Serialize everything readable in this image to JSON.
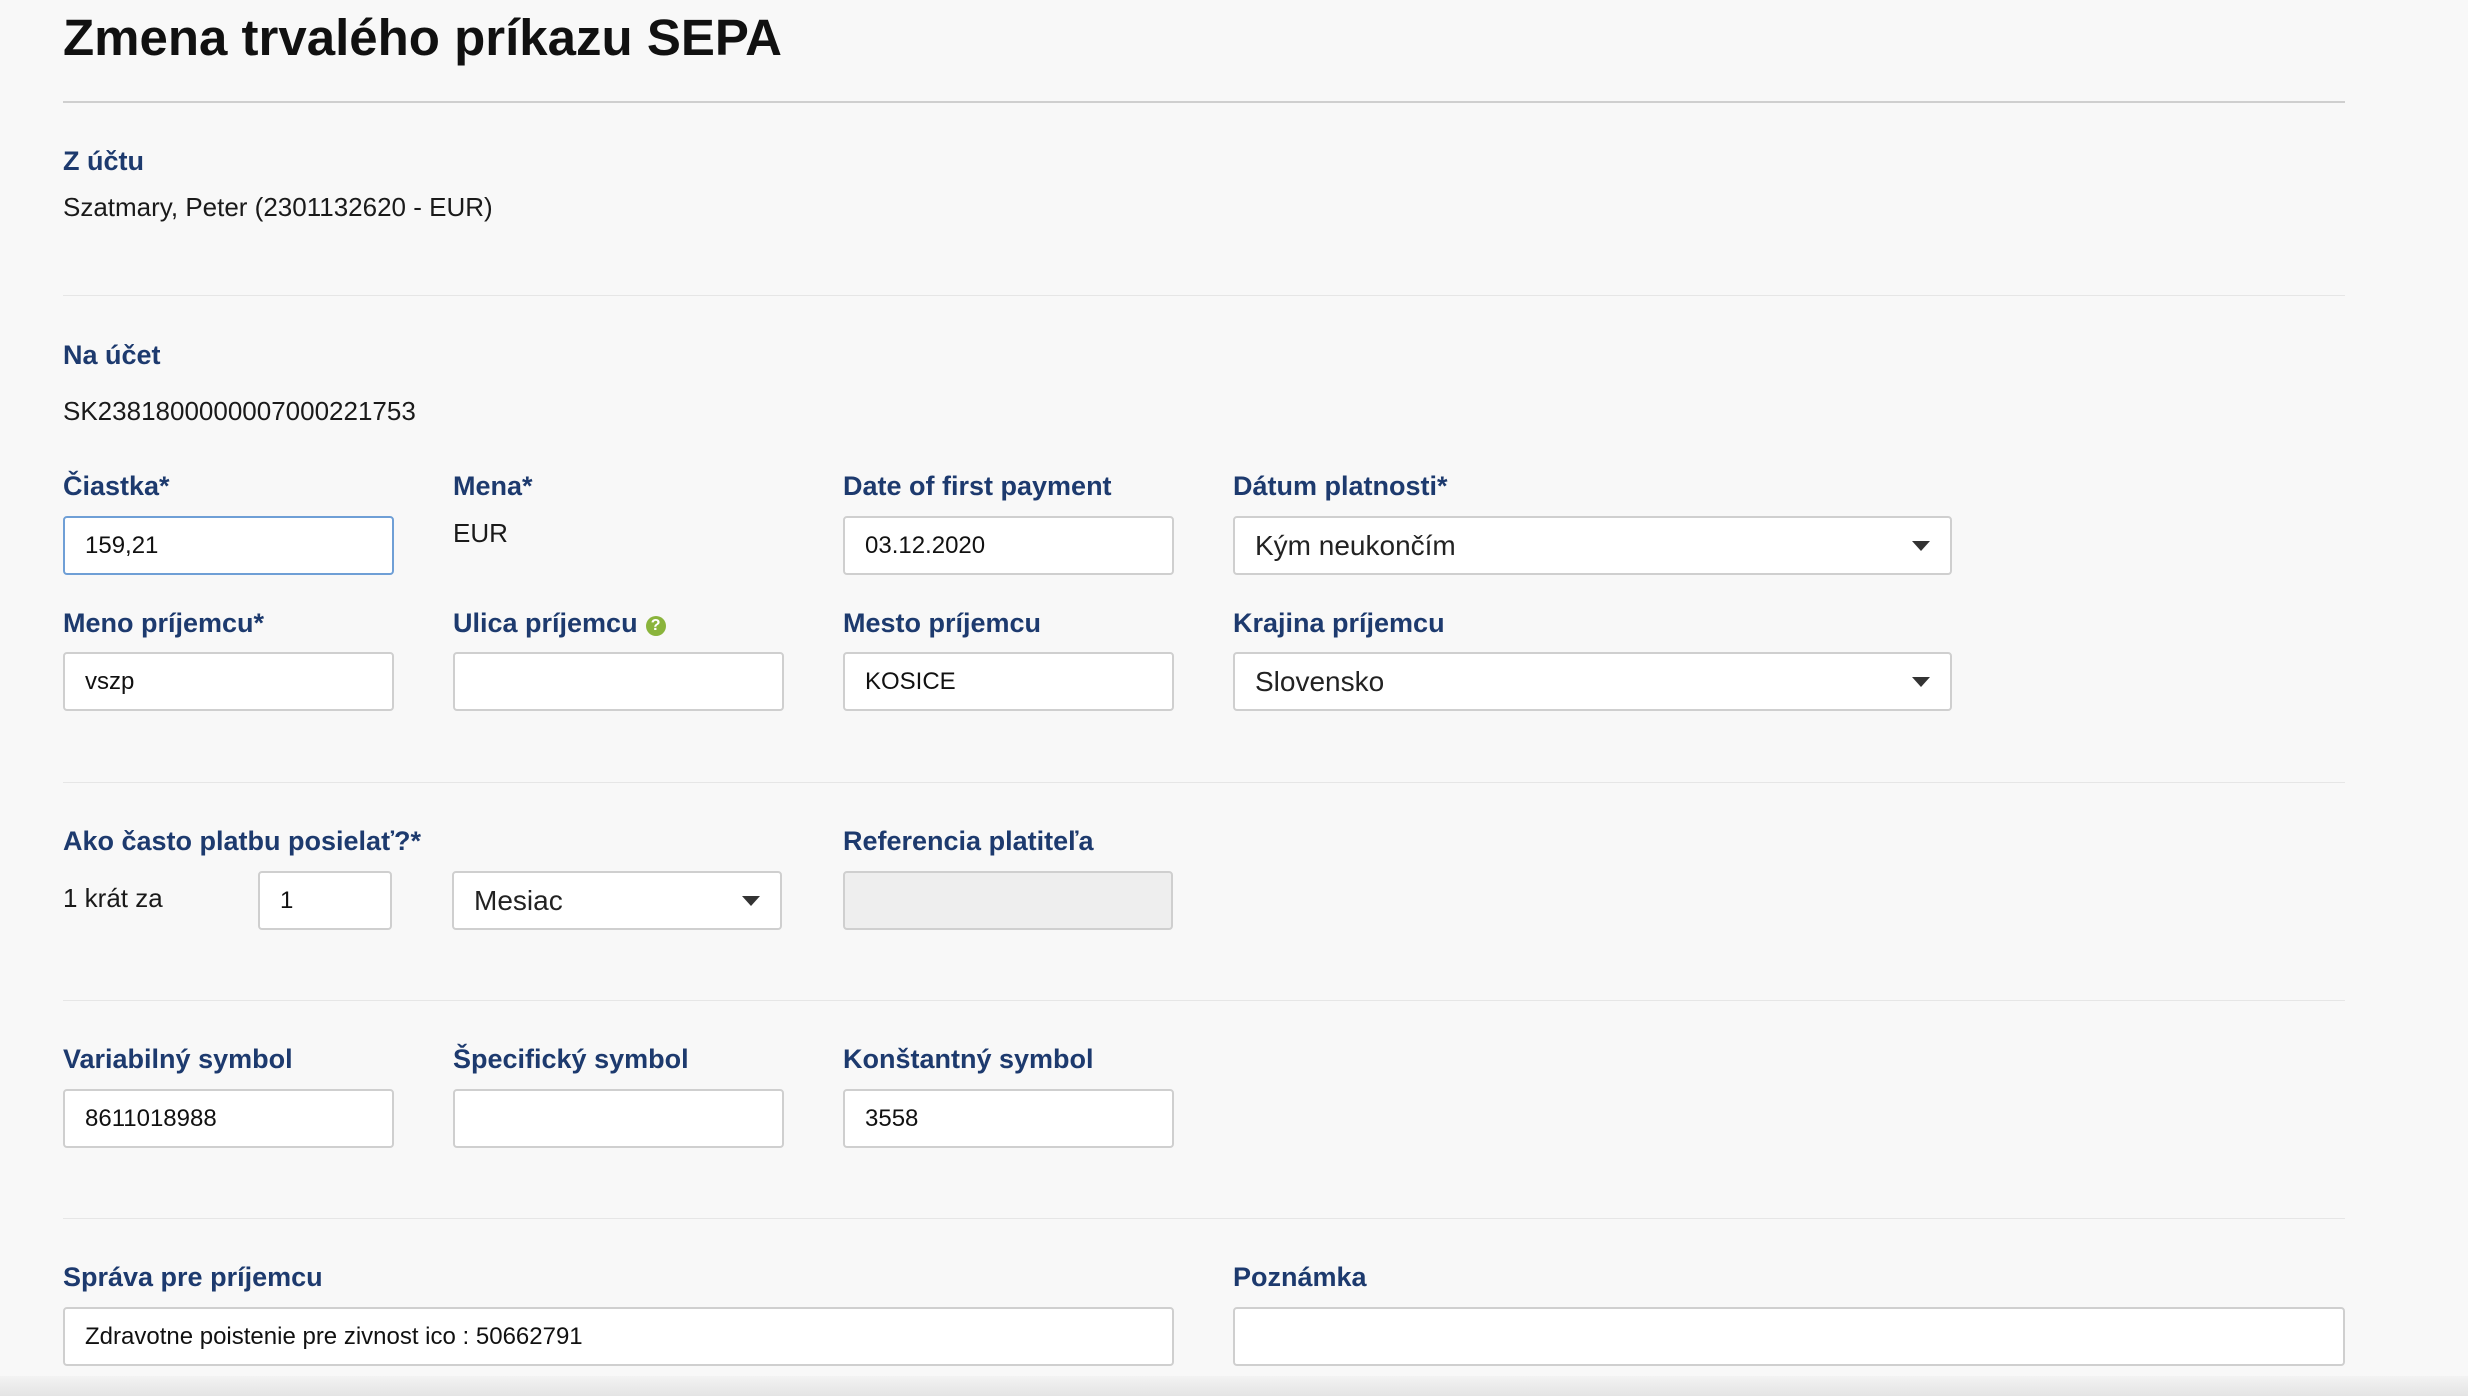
{
  "page": {
    "title": "Zmena trvalého príkazu SEPA"
  },
  "from_account": {
    "label": "Z účtu",
    "value": "Szatmary, Peter (2301132620 - EUR)"
  },
  "to_account": {
    "label": "Na účet",
    "value": "SK2381800000007000221753"
  },
  "amount": {
    "label": "Čiastka*",
    "value": "159,21"
  },
  "currency": {
    "label": "Mena*",
    "value": "EUR"
  },
  "first_payment": {
    "label": "Date of first payment",
    "value": "03.12.2020",
    "icon": "calendar-icon"
  },
  "validity": {
    "label": "Dátum platnosti*",
    "selected": "Kým neukončím"
  },
  "recipient_name": {
    "label": "Meno príjemcu*",
    "value": "vszp"
  },
  "recipient_street": {
    "label": "Ulica príjemcu",
    "help": "?",
    "value": ""
  },
  "recipient_city": {
    "label": "Mesto príjemcu",
    "value": "KOSICE"
  },
  "recipient_country": {
    "label": "Krajina príjemcu",
    "selected": "Slovensko"
  },
  "frequency": {
    "label": "Ako často platbu posielať?*",
    "prefix": "1 krát za",
    "count": "1",
    "period": "Mesiac"
  },
  "payer_reference": {
    "label": "Referencia platiteľa",
    "value": ""
  },
  "variable_symbol": {
    "label": "Variabilný symbol",
    "value": "8611018988"
  },
  "specific_symbol": {
    "label": "Špecifický symbol",
    "value": ""
  },
  "constant_symbol": {
    "label": "Konštantný symbol",
    "value": "3558"
  },
  "message": {
    "label": "Správa pre príjemcu",
    "value": "Zdravotne poistenie pre zivnost ico : 50662791"
  },
  "note": {
    "label": "Poznámka",
    "value": ""
  },
  "colors": {
    "label": "#1d3a6e",
    "help_icon": "#8ab43c",
    "focus_border": "#6f9fd6"
  }
}
